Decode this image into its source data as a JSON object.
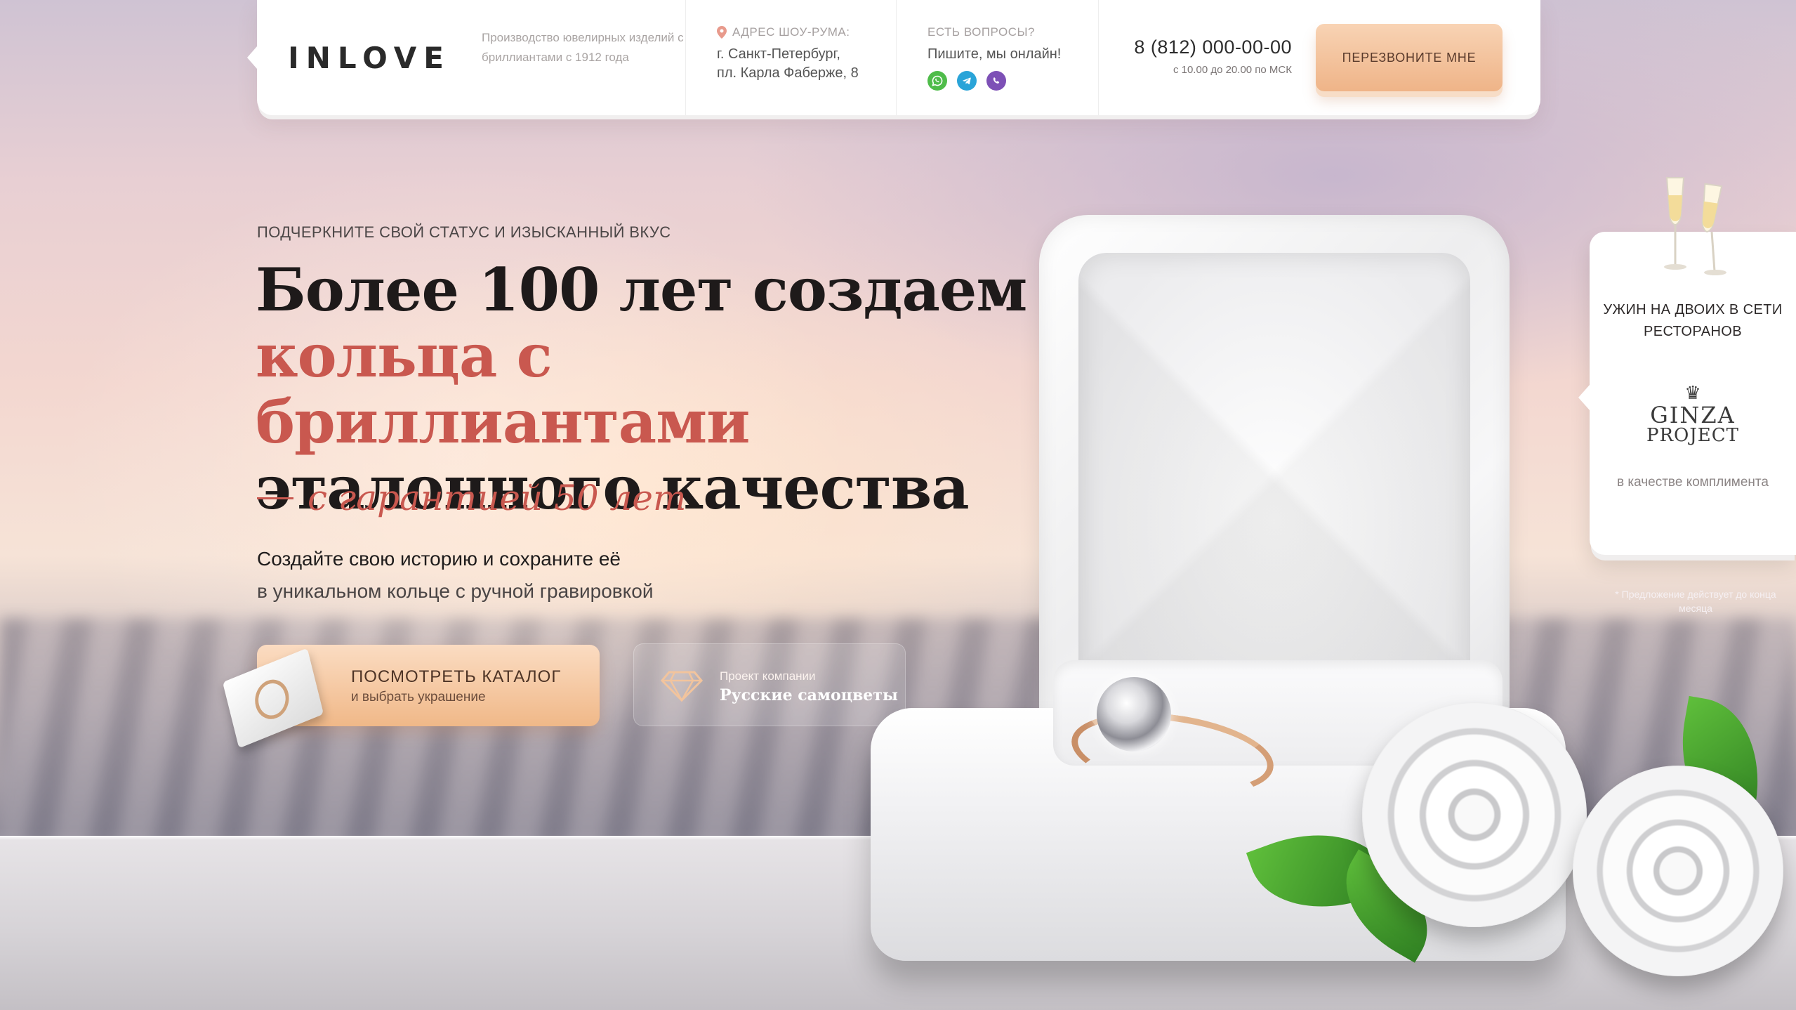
{
  "brand": {
    "logo": "INLOVE"
  },
  "header": {
    "tagline": "Производство ювелирных изделий с бриллиантами с 1912 года",
    "address_label": "АДРЕС ШОУ-РУМА:",
    "address_line1": "г. Санкт-Петербург,",
    "address_line2": "пл. Карла Фаберже, 8",
    "questions_label": "ЕСТЬ ВОПРОСЫ?",
    "questions_text": "Пишите, мы онлайн!",
    "messengers": [
      "whatsapp-icon",
      "telegram-icon",
      "viber-icon"
    ],
    "phone": "8 (812) 000-00-00",
    "hours": "с 10.00 до 20.00 по МСК",
    "callback_label": "ПЕРЕЗВОНИТЕ МНЕ"
  },
  "hero": {
    "subtitle": "ПОДЧЕРКНИТЕ СВОЙ СТАТУС И ИЗЫСКАННЫЙ ВКУС",
    "headline_line1": "Более 100 лет создаем",
    "headline_line2": "кольца с бриллиантами",
    "headline_line3": "эталонного качества",
    "guarantee": "с гарантией 50 лет",
    "story_line1": "Создайте свою историю и сохраните её",
    "story_line2": "в уникальном кольце с ручной гравировкой",
    "catalog_title": "ПОСМОТРЕТЬ КАТАЛОГ",
    "catalog_sub": "и выбрать украшение",
    "project_label": "Проект компании",
    "project_name": "Русские самоцветы"
  },
  "promo": {
    "title": "УЖИН НА ДВОИХ В СЕТИ РЕСТОРАНОВ",
    "partner_line1": "GINZA",
    "partner_line2": "PROJECT",
    "bonus": "в качестве комплимента",
    "note": "* Предложение действует до конца месяца"
  },
  "colors": {
    "accent": "#c9584f",
    "button_peach": "#f0b888",
    "whatsapp": "#4fbc4a",
    "telegram": "#2aa4d8",
    "viber": "#7d50b6"
  }
}
